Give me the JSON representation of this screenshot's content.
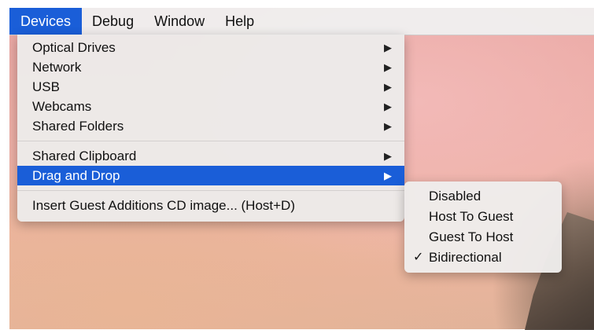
{
  "menubar": {
    "items": [
      {
        "label": "Devices",
        "active": true
      },
      {
        "label": "Debug",
        "active": false
      },
      {
        "label": "Window",
        "active": false
      },
      {
        "label": "Help",
        "active": false
      }
    ]
  },
  "devices_menu": {
    "group1": [
      {
        "label": "Optical Drives",
        "submenu": true
      },
      {
        "label": "Network",
        "submenu": true
      },
      {
        "label": "USB",
        "submenu": true
      },
      {
        "label": "Webcams",
        "submenu": true
      },
      {
        "label": "Shared Folders",
        "submenu": true
      }
    ],
    "group2": [
      {
        "label": "Shared Clipboard",
        "submenu": true
      },
      {
        "label": "Drag and Drop",
        "submenu": true,
        "highlighted": true
      }
    ],
    "group3": [
      {
        "label": "Insert Guest Additions CD image... (Host+D)",
        "submenu": false
      }
    ],
    "submenu_arrow": "▶"
  },
  "drag_drop_submenu": {
    "items": [
      {
        "label": "Disabled",
        "checked": false
      },
      {
        "label": "Host To Guest",
        "checked": false
      },
      {
        "label": "Guest To Host",
        "checked": false
      },
      {
        "label": "Bidirectional",
        "checked": true
      }
    ],
    "check_glyph": "✓"
  },
  "colors": {
    "accent": "#1a5ed8"
  }
}
